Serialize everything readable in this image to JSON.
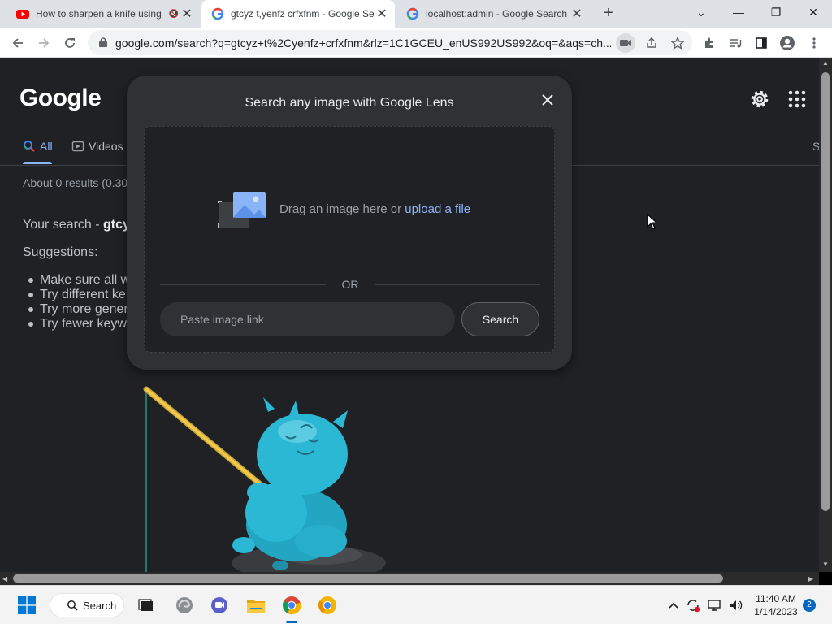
{
  "tabs": [
    {
      "title": "How to sharpen a knife using",
      "muted": true
    },
    {
      "title": "gtcyz t,yenfz crfxfnm - Google Se",
      "active": true
    },
    {
      "title": "localhost:admin - Google Search"
    }
  ],
  "tab_close_glyph": "✕",
  "new_tab_glyph": "+",
  "window_controls": {
    "chevron": "⌄",
    "minimize": "—",
    "restore": "❐",
    "close": "✕"
  },
  "address_bar": {
    "url": "google.com/search?q=gtcyz+t%2Cyenfz+crfxfnm&rlz=1C1GCEU_enUS992US992&oq=&aqs=ch..."
  },
  "page": {
    "logo": "Google",
    "nav": {
      "all": "All",
      "videos": "Videos",
      "right_clip": "S"
    },
    "results_stats": "About 0 results (0.30",
    "your_search_prefix": "Your search - ",
    "your_search_query": "gtcy",
    "suggestions_label": "Suggestions:",
    "suggestions": [
      "Make sure all w",
      "Try different ke",
      "Try more gener",
      "Try fewer keyw"
    ]
  },
  "lens_modal": {
    "title": "Search any image with Google Lens",
    "drag_text": "Drag an image here or ",
    "upload_link": "upload a file",
    "or_label": "OR",
    "link_placeholder": "Paste image link",
    "search_button": "Search"
  },
  "taskbar": {
    "search_label": "Search",
    "time": "11:40 AM",
    "date": "1/14/2023",
    "notifications": "2"
  },
  "icons": {
    "lock": "lock-icon",
    "camera": "camera-icon",
    "share": "share-icon",
    "star": "star-icon",
    "extensions": "puzzle-icon",
    "media": "media-icon",
    "side_panel": "side-panel-icon",
    "profile": "profile-icon",
    "menu": "more-vert-icon"
  },
  "colors": {
    "accent_blue": "#8ab4f8",
    "page_bg": "#202124",
    "modal_bg": "#303134"
  }
}
